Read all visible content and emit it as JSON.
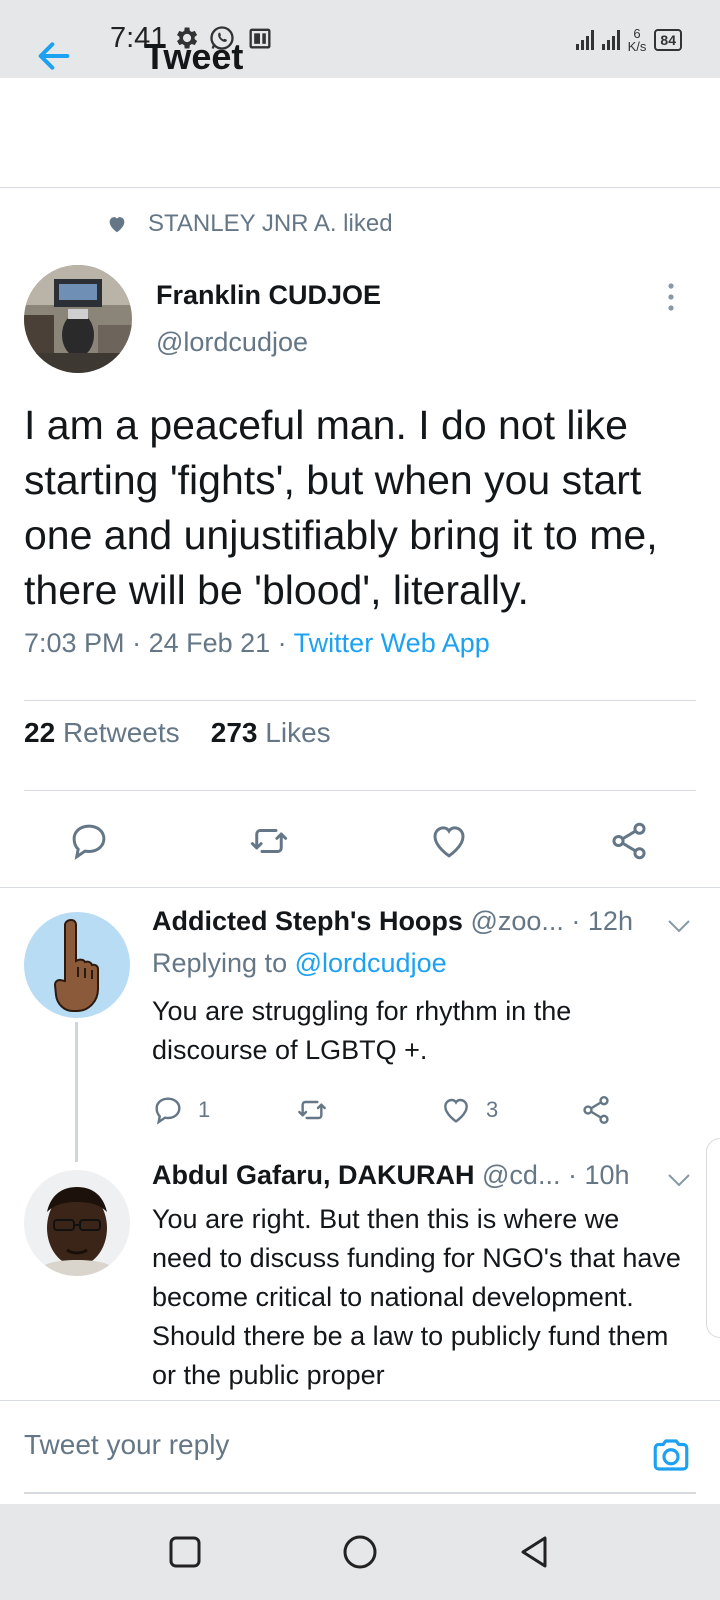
{
  "status_bar": {
    "time": "7:41",
    "network_speed_value": "6",
    "network_speed_unit": "K/s",
    "battery": "84"
  },
  "header": {
    "title": "Tweet"
  },
  "social_context": {
    "text": "STANLEY JNR A. liked"
  },
  "tweet": {
    "author_name": "Franklin CUDJOE",
    "author_handle": "@lordcudjoe",
    "text": "I am a peaceful man. I do not like starting 'fights', but when you start one and unjustifiably bring it to me, there will be 'blood', literally.",
    "time": "7:03 PM",
    "date": "24 Feb 21",
    "source": "Twitter Web App",
    "retweets_count": "22",
    "retweets_label": "Retweets",
    "likes_count": "273",
    "likes_label": "Likes"
  },
  "replies": [
    {
      "name": "Addicted Steph's Hoops",
      "handle": "@zoo...",
      "time": "· 12h",
      "replying_prefix": "Replying to",
      "replying_to": "@lordcudjoe",
      "text": "You are struggling for rhythm in the discourse of LGBTQ +.",
      "reply_count": "1",
      "like_count": "3"
    },
    {
      "name": "Abdul Gafaru, DAKURAH",
      "handle": "@cd...",
      "time": "· 10h",
      "text": "You are right. But then this is where we need to discuss funding for NGO's that have become critical to national development. Should there be a law to publicly fund them or the public proper"
    }
  ],
  "composer": {
    "placeholder": "Tweet your reply"
  },
  "colors": {
    "accent": "#1da1f2",
    "muted": "#657786",
    "text": "#14171a",
    "divider": "#d7dbdf",
    "system_bar": "#e6e7e9"
  },
  "icons": {
    "back": "arrow-left-icon",
    "liked": "heart-filled-icon",
    "more": "vertical-ellipsis-icon",
    "reply": "speech-bubble-icon",
    "retweet": "retweet-icon",
    "like": "heart-outline-icon",
    "share": "share-icon",
    "camera": "camera-icon",
    "caret": "chevron-down-icon"
  }
}
